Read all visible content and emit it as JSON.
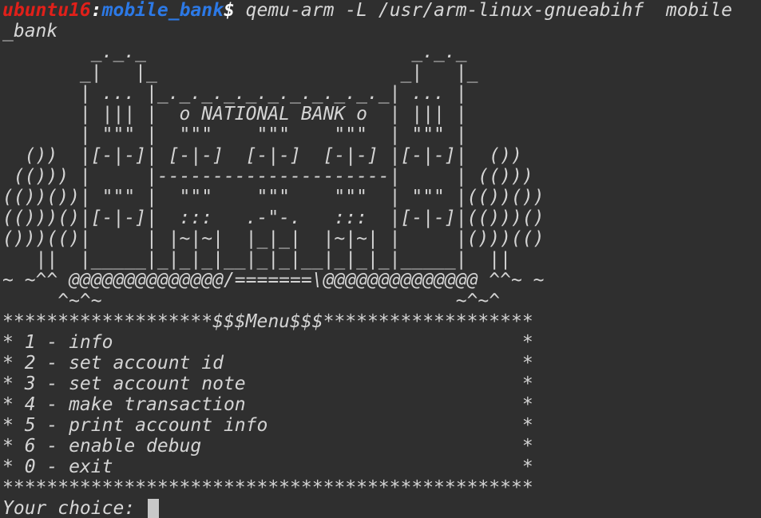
{
  "prompt": {
    "host": "ubuntu16",
    "sep": ":",
    "path": "mobile_bank",
    "dollar": "$",
    "command": " qemu-arm -L /usr/arm-linux-gnueabihf  mobile",
    "command_wrap": "_bank"
  },
  "banner": [
    "        _._._                        _._._",
    "       _|   |_                      _|   |_",
    "       | ... |_._._._._._._._._._._| ... |",
    "       | ||| |  o NATIONAL BANK o  | ||| |",
    "       | \"\"\" |  \"\"\"    \"\"\"    \"\"\"  | \"\"\" |",
    "  ())  |[-|-]| [-|-]  [-|-]  [-|-] |[-|-]|  ())",
    " (())) |     |---------------------|     | (()))",
    "(())())| \"\"\" |  \"\"\"    \"\"\"    \"\"\"  | \"\"\" |(())())",
    "(()))()|[-|-]|  :::   .-\"-.   :::  |[-|-]|(()))()",
    "()))(()|     | |~|~|  |_|_|  |~|~| |     |()))(()",
    "   ||  |_____|_|_|_|__|_|_|__|_|_|_|_____|  ||",
    "~ ~^^ @@@@@@@@@@@@@@/=======\\@@@@@@@@@@@@@@ ^^~ ~",
    "     ^~^~                                ~^~^"
  ],
  "menu": {
    "border_top": "*******************$$$Menu$$$*******************",
    "items": [
      "* 1 - info                                     *",
      "* 2 - set account id                           *",
      "* 3 - set account note                         *",
      "* 4 - make transaction                         *",
      "* 5 - print account info                       *",
      "* 6 - enable debug                             *",
      "* 0 - exit                                     *"
    ],
    "border_bottom": "************************************************"
  },
  "input": {
    "label": "Your choice: ",
    "value": ""
  }
}
